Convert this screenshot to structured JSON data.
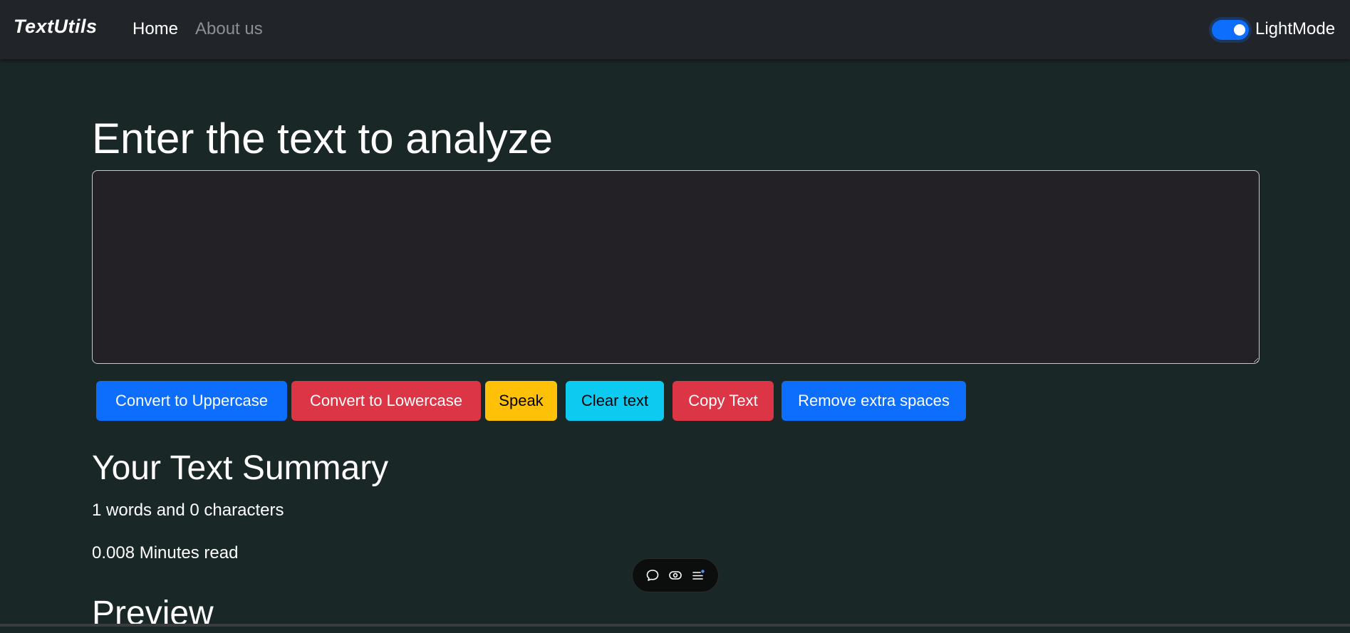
{
  "navbar": {
    "brand": "TextUtils",
    "links": [
      {
        "label": "Home",
        "active": true
      },
      {
        "label": "About us",
        "active": false
      }
    ],
    "mode_toggle": {
      "label": "LightMode",
      "checked": true
    }
  },
  "main": {
    "heading": "Enter the text to analyze",
    "textarea": {
      "value": ""
    },
    "buttons": {
      "uppercase": "Convert to Uppercase",
      "lowercase": "Convert to Lowercase",
      "speak": "Speak",
      "clear": "Clear text",
      "copy": "Copy Text",
      "remove_spaces": "Remove extra spaces"
    },
    "summary": {
      "title": "Your Text Summary",
      "words_line": "1 words and 0 characters",
      "read_line": "0.008 Minutes read"
    },
    "preview": {
      "title": "Preview"
    }
  },
  "floating_toolbar": {
    "icons": [
      "chat-bubble-icon",
      "eye-icon",
      "menu-icon"
    ]
  },
  "colors": {
    "background": "#1a2727",
    "navbar": "#212529",
    "primary": "#0d6efd",
    "danger": "#dc3545",
    "warning": "#ffc107",
    "info": "#0dcaf0",
    "textarea_bg": "#232126"
  }
}
